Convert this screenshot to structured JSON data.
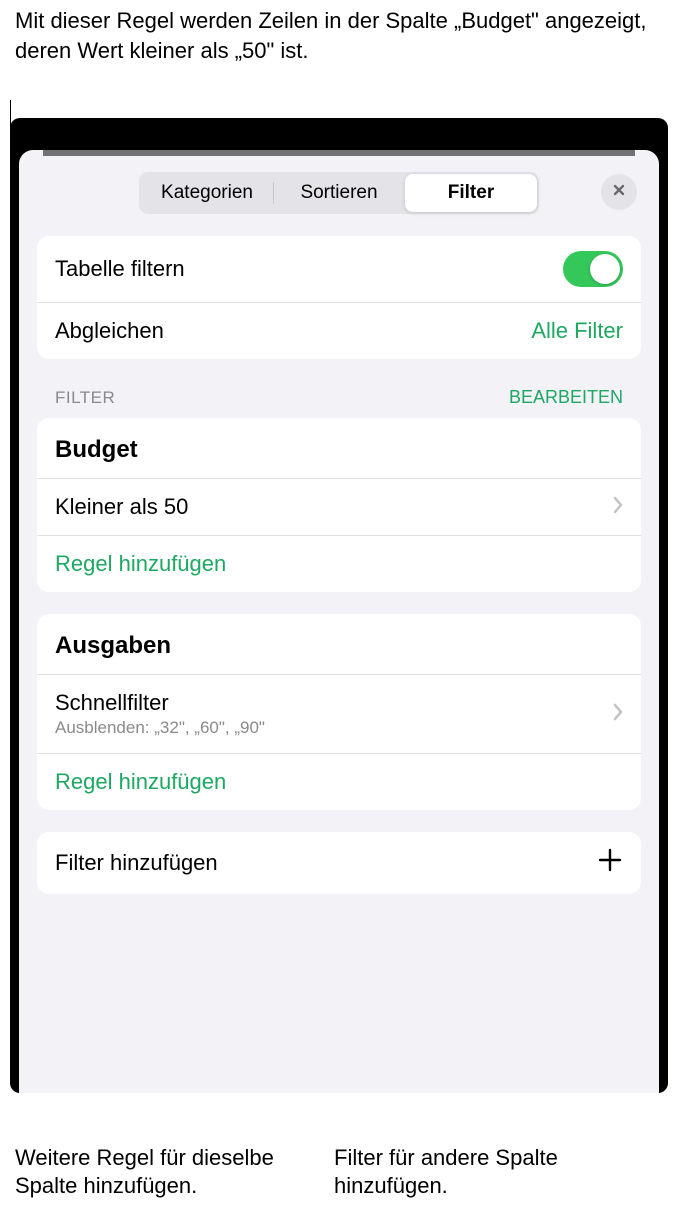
{
  "annotations": {
    "top": "Mit dieser Regel werden Zeilen in der Spalte „Budget\" angezeigt, deren Wert kleiner als „50\" ist.",
    "bottom_left": "Weitere Regel für dieselbe Spalte hinzufügen.",
    "bottom_right": "Filter für andere Spalte hinzufügen."
  },
  "tabs": {
    "categories": "Kategorien",
    "sort": "Sortieren",
    "filter": "Filter"
  },
  "top_section": {
    "filter_table": "Tabelle filtern",
    "match_label": "Abgleichen",
    "match_value": "Alle Filter"
  },
  "list_header": {
    "title": "FILTER",
    "edit": "BEARBEITEN"
  },
  "group1": {
    "title": "Budget",
    "rule": "Kleiner als 50",
    "add_rule": "Regel hinzufügen"
  },
  "group2": {
    "title": "Ausgaben",
    "rule_title": "Schnellfilter",
    "rule_sub": "Ausblenden: „32\", „60\", „90\"",
    "add_rule": "Regel hinzufügen"
  },
  "add_filter": "Filter hinzufügen"
}
